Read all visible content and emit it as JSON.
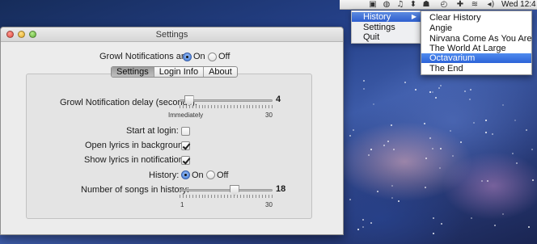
{
  "menubar": {
    "clock": "Wed 12:4",
    "icons": [
      "growl-app-icon",
      "screen-icon",
      "globe-icon",
      "music-note-icon",
      "upload-icon",
      "robot-icon",
      "clock-icon",
      "add-icon",
      "wifi-icon",
      "volume-icon"
    ]
  },
  "status_menu": {
    "items": [
      {
        "label": "History",
        "highlighted": true,
        "has_submenu": true
      },
      {
        "label": "Settings"
      },
      {
        "label": "Quit"
      }
    ]
  },
  "history_menu": {
    "items": [
      {
        "label": "Clear History"
      },
      {
        "label": "Angie"
      },
      {
        "label": "Nirvana Come As You Are"
      },
      {
        "label": "The World At Large"
      },
      {
        "label": "Octavarium",
        "highlighted": true
      },
      {
        "label": "The End"
      }
    ]
  },
  "window": {
    "title": "Settings",
    "growl": {
      "label": "Growl Notifications are:",
      "on_label": "On",
      "off_label": "Off",
      "selected": "On"
    },
    "tabs": [
      {
        "label": "Settings",
        "active": true
      },
      {
        "label": "Login Info"
      },
      {
        "label": "About"
      }
    ],
    "delay": {
      "label": "Growl Notification delay (seconds):",
      "value": "4",
      "min_label": "Immediately",
      "max_label": "30",
      "fraction": 0.1
    },
    "start_login": {
      "label": "Start at login:",
      "checked": false
    },
    "open_bg": {
      "label": "Open lyrics in background:",
      "checked": true
    },
    "show_lyrics": {
      "label": "Show lyrics in notifications:",
      "checked": true
    },
    "history": {
      "label": "History:",
      "on_label": "On",
      "off_label": "Off",
      "selected": "On"
    },
    "songs": {
      "label": "Number of songs in history:",
      "value": "18",
      "min_label": "1",
      "max_label": "30",
      "fraction": 0.59
    }
  }
}
